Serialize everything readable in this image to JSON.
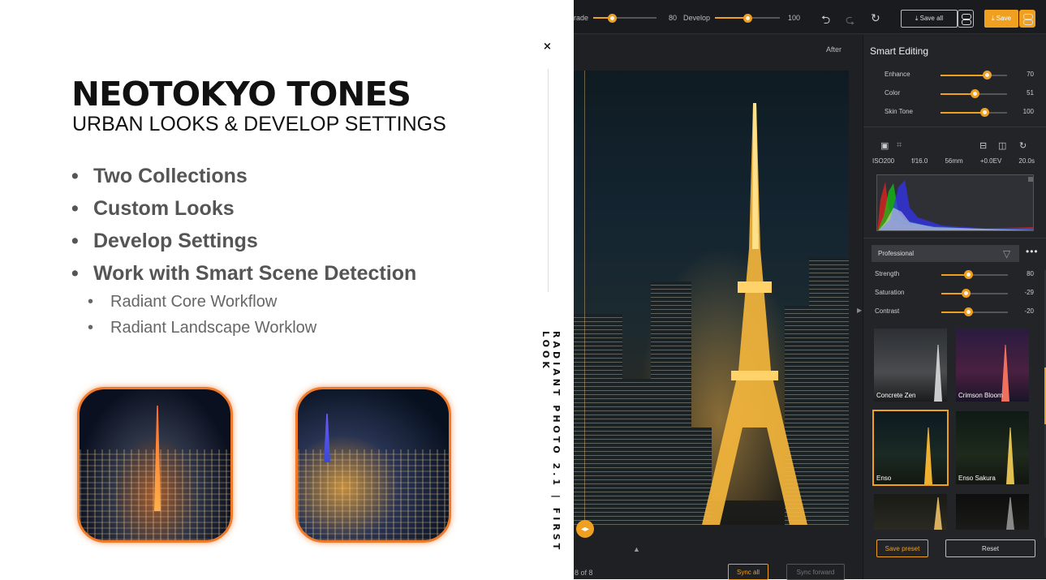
{
  "slide": {
    "title": "NEOTOKYO TONES",
    "subtitle": "URBAN LOOKS & DEVELOP SETTINGS",
    "bullets": [
      "Two Collections",
      "Custom Looks",
      "Develop Settings",
      "Work with Smart Scene Detection"
    ],
    "sub_bullets": [
      "Radiant Core Workflow",
      "Radiant Landscape Worklow"
    ],
    "vertical_label": "RADIANT PHOTO 2.1 | FIRST LOOK",
    "close_icon": "×"
  },
  "topbar": {
    "grade_label": "rade",
    "grade_value": "80",
    "grade_level": 0.29,
    "develop_label": "Develop",
    "develop_value": "100",
    "develop_level": 0.5,
    "undo_icon": "undo-icon",
    "redo_icon": "redo-icon",
    "reset_icon": "reset-icon",
    "save_all_label": "⤓ Save all",
    "save_label": "⤓ Save"
  },
  "canvas": {
    "after_label": "After",
    "page_count": "8 of 8",
    "sync_all": "Sync all",
    "sync_forward": "Sync forward",
    "up_arrow": "▲"
  },
  "smart_editing": {
    "title": "Smart Editing",
    "rows": [
      {
        "label": "Enhance",
        "value": "70",
        "level": 0.7
      },
      {
        "label": "Color",
        "value": "51",
        "level": 0.51
      },
      {
        "label": "Skin Tone",
        "value": "100",
        "level": 0.66
      }
    ]
  },
  "exif": {
    "iso": "ISO200",
    "aperture": "f/16.0",
    "focal": "56mm",
    "ev": "+0.0EV",
    "shutter": "20.0s"
  },
  "presets": {
    "selected": "Professional",
    "rows": [
      {
        "label": "Strength",
        "value": "80",
        "level": 0.4
      },
      {
        "label": "Saturation",
        "value": "-29",
        "level": 0.36
      },
      {
        "label": "Contrast",
        "value": "-20",
        "level": 0.4
      }
    ],
    "looks": [
      "Concrete Zen",
      "Crimson Bloom",
      "Enso",
      "Enso Sakura",
      "",
      ""
    ],
    "save_preset": "Save preset",
    "reset": "Reset"
  },
  "colors": {
    "accent": "#f0a020",
    "panel_bg": "#222428",
    "thumb_border": "#f07a2a"
  }
}
